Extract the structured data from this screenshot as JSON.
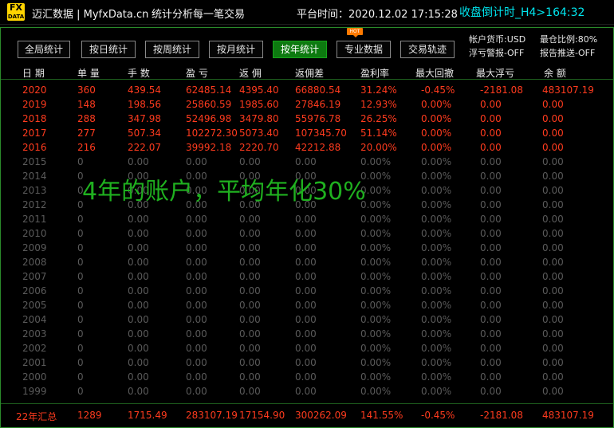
{
  "titlebar": {
    "logo_top": "FX",
    "logo_bottom": "DATA",
    "app_title": "迈汇数据 | MyfxData.cn",
    "subtitle": "统计分析每一笔交易",
    "platform_time": "平台时间：2020.12.02 17:15:28",
    "countdown": "收盘倒计时_H4>164:32"
  },
  "tabs": [
    {
      "label": "全局统计",
      "active": false
    },
    {
      "label": "按日统计",
      "active": false
    },
    {
      "label": "按周统计",
      "active": false
    },
    {
      "label": "按月统计",
      "active": false
    },
    {
      "label": "按年统计",
      "active": true
    },
    {
      "label": "专业数据",
      "active": false
    },
    {
      "label": "交易轨迹",
      "active": false
    }
  ],
  "hot_badge": "HOT",
  "info": {
    "currency": "帐户货币:USD",
    "max_ratio": "最仓比例:80%",
    "float_alert": "浮亏警报-OFF",
    "report_push": "报告推送-OFF"
  },
  "columns": [
    "日 期",
    "单 量",
    "手 数",
    "盈 亏",
    "返 佣",
    "返佣差",
    "盈利率",
    "最大回撤",
    "最大浮亏",
    "余 额"
  ],
  "rows": [
    [
      "2020",
      "360",
      "439.54",
      "62485.14",
      "4395.40",
      "66880.54",
      "31.24%",
      "-0.45%",
      "-2181.08",
      "483107.19"
    ],
    [
      "2019",
      "148",
      "198.56",
      "25860.59",
      "1985.60",
      "27846.19",
      "12.93%",
      "0.00%",
      "0.00",
      "0.00"
    ],
    [
      "2018",
      "288",
      "347.98",
      "52496.98",
      "3479.80",
      "55976.78",
      "26.25%",
      "0.00%",
      "0.00",
      "0.00"
    ],
    [
      "2017",
      "277",
      "507.34",
      "102272.30",
      "5073.40",
      "107345.70",
      "51.14%",
      "0.00%",
      "0.00",
      "0.00"
    ],
    [
      "2016",
      "216",
      "222.07",
      "39992.18",
      "2220.70",
      "42212.88",
      "20.00%",
      "0.00%",
      "0.00",
      "0.00"
    ],
    [
      "2015",
      "0",
      "0.00",
      "0.00",
      "0.00",
      "0.00",
      "0.00%",
      "0.00%",
      "0.00",
      "0.00"
    ],
    [
      "2014",
      "0",
      "0.00",
      "0.00",
      "0.00",
      "0.00",
      "0.00%",
      "0.00%",
      "0.00",
      "0.00"
    ],
    [
      "2013",
      "0",
      "0.00",
      "0.00",
      "0.00",
      "0.00",
      "0.00%",
      "0.00%",
      "0.00",
      "0.00"
    ],
    [
      "2012",
      "0",
      "0.00",
      "0.00",
      "0.00",
      "0.00",
      "0.00%",
      "0.00%",
      "0.00",
      "0.00"
    ],
    [
      "2011",
      "0",
      "0.00",
      "0.00",
      "0.00",
      "0.00",
      "0.00%",
      "0.00%",
      "0.00",
      "0.00"
    ],
    [
      "2010",
      "0",
      "0.00",
      "0.00",
      "0.00",
      "0.00",
      "0.00%",
      "0.00%",
      "0.00",
      "0.00"
    ],
    [
      "2009",
      "0",
      "0.00",
      "0.00",
      "0.00",
      "0.00",
      "0.00%",
      "0.00%",
      "0.00",
      "0.00"
    ],
    [
      "2008",
      "0",
      "0.00",
      "0.00",
      "0.00",
      "0.00",
      "0.00%",
      "0.00%",
      "0.00",
      "0.00"
    ],
    [
      "2007",
      "0",
      "0.00",
      "0.00",
      "0.00",
      "0.00",
      "0.00%",
      "0.00%",
      "0.00",
      "0.00"
    ],
    [
      "2006",
      "0",
      "0.00",
      "0.00",
      "0.00",
      "0.00",
      "0.00%",
      "0.00%",
      "0.00",
      "0.00"
    ],
    [
      "2005",
      "0",
      "0.00",
      "0.00",
      "0.00",
      "0.00",
      "0.00%",
      "0.00%",
      "0.00",
      "0.00"
    ],
    [
      "2004",
      "0",
      "0.00",
      "0.00",
      "0.00",
      "0.00",
      "0.00%",
      "0.00%",
      "0.00",
      "0.00"
    ],
    [
      "2003",
      "0",
      "0.00",
      "0.00",
      "0.00",
      "0.00",
      "0.00%",
      "0.00%",
      "0.00",
      "0.00"
    ],
    [
      "2002",
      "0",
      "0.00",
      "0.00",
      "0.00",
      "0.00",
      "0.00%",
      "0.00%",
      "0.00",
      "0.00"
    ],
    [
      "2001",
      "0",
      "0.00",
      "0.00",
      "0.00",
      "0.00",
      "0.00%",
      "0.00%",
      "0.00",
      "0.00"
    ],
    [
      "2000",
      "0",
      "0.00",
      "0.00",
      "0.00",
      "0.00",
      "0.00%",
      "0.00%",
      "0.00",
      "0.00"
    ],
    [
      "1999",
      "0",
      "0.00",
      "0.00",
      "0.00",
      "0.00",
      "0.00%",
      "0.00%",
      "0.00",
      "0.00"
    ]
  ],
  "summary": [
    "22年汇总",
    "1289",
    "1715.49",
    "283107.19",
    "17154.90",
    "300262.09",
    "141.55%",
    "-0.45%",
    "-2181.08",
    "483107.19"
  ],
  "overlay_text": "4年的账户，平均年化30%",
  "colors": {
    "accent_green": "#0d7a10",
    "active_text": "#ff3b1e",
    "inactive_text": "#5a5a5a",
    "countdown": "#00e5ee",
    "overlay": "#1fb01f",
    "logo": "#ffd400"
  }
}
